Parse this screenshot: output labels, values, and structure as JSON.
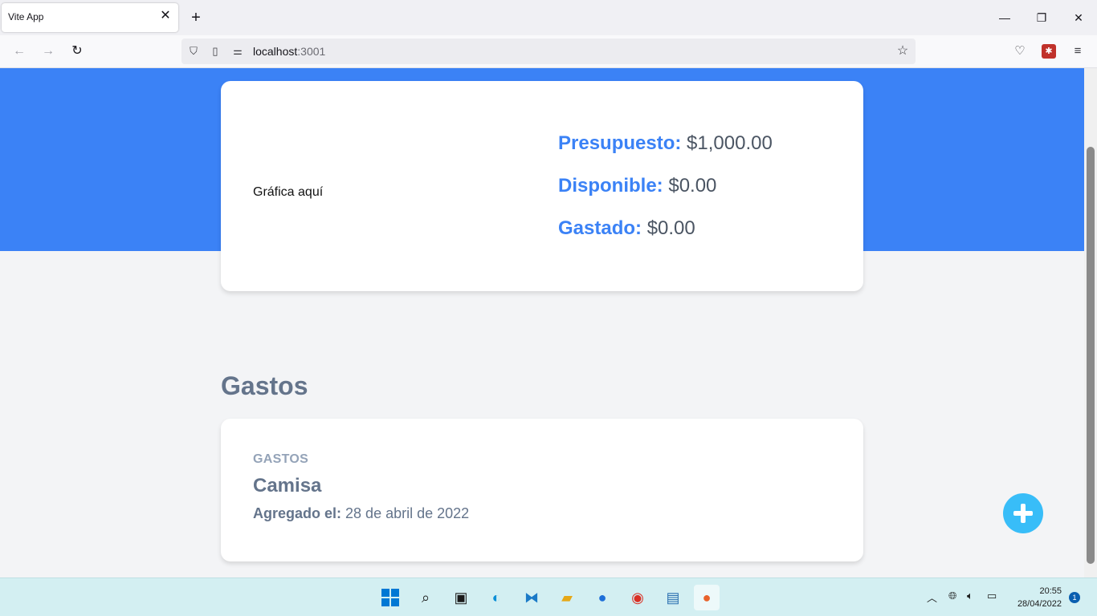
{
  "browser": {
    "tab_title": "Vite App",
    "tab_close": "✕",
    "new_tab": "+",
    "window_controls": {
      "minimize": "—",
      "maximize": "❐",
      "close": "✕"
    },
    "url_host": "localhost",
    "url_port": ":3001"
  },
  "app": {
    "accent_color": "#3b82f6",
    "chart_placeholder": "Gráfica aquí",
    "budget": {
      "presupuesto_label": "Presupuesto:",
      "presupuesto_value": "$1,000.00",
      "disponible_label": "Disponible:",
      "disponible_value": "$0.00",
      "gastado_label": "Gastado:",
      "gastado_value": "$0.00"
    },
    "section_title": "Gastos",
    "expenses": [
      {
        "category": "Gastos",
        "name": "Camisa",
        "date_label": "Agregado el:",
        "date_value": "28 de abril de 2022"
      }
    ]
  },
  "taskbar": {
    "time": "20:55",
    "date": "28/04/2022",
    "notifications": "1"
  }
}
